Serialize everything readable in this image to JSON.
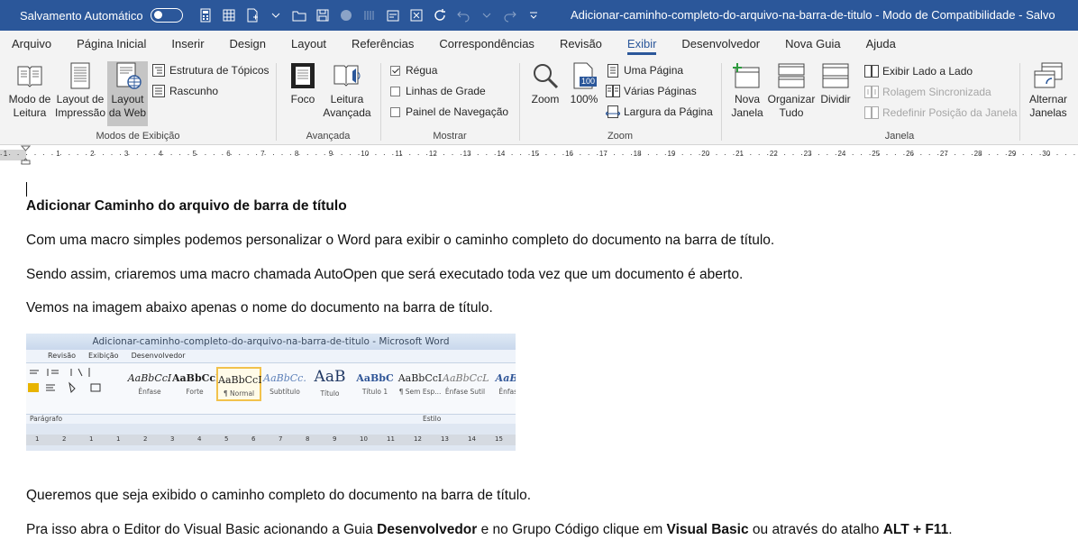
{
  "titlebar": {
    "autosave_label": "Salvamento Automático",
    "document_title": "Adicionar-caminho-completo-do-arquivo-na-barra-de-titulo  -  Modo de Compatibilidade  -  Salvo"
  },
  "tabs": [
    {
      "label": "Arquivo"
    },
    {
      "label": "Página Inicial"
    },
    {
      "label": "Inserir"
    },
    {
      "label": "Design"
    },
    {
      "label": "Layout"
    },
    {
      "label": "Referências"
    },
    {
      "label": "Correspondências"
    },
    {
      "label": "Revisão"
    },
    {
      "label": "Exibir",
      "active": true
    },
    {
      "label": "Desenvolvedor"
    },
    {
      "label": "Nova Guia"
    },
    {
      "label": "Ajuda"
    }
  ],
  "ribbon": {
    "views": {
      "label": "Modos de Exibição",
      "read_mode": "Modo de\nLeitura",
      "print_layout": "Layout de\nImpressão",
      "web_layout": "Layout\nda Web",
      "outline": "Estrutura de Tópicos",
      "draft": "Rascunho"
    },
    "immersive": {
      "label": "Avançada",
      "focus": "Foco",
      "immersive_reader": "Leitura\nAvançada"
    },
    "show": {
      "label": "Mostrar",
      "ruler": "Régua",
      "gridlines": "Linhas de Grade",
      "nav_pane": "Painel de Navegação"
    },
    "zoom": {
      "label": "Zoom",
      "zoom": "Zoom",
      "percent": "100%",
      "icon_badge": "100",
      "one_page": "Uma Página",
      "multiple_pages": "Várias Páginas",
      "page_width": "Largura da Página"
    },
    "window": {
      "label": "Janela",
      "new_window": "Nova\nJanela",
      "arrange_all": "Organizar\nTudo",
      "split": "Dividir",
      "side_by_side": "Exibir Lado a Lado",
      "sync_scroll": "Rolagem Sincronizada",
      "reset_position": "Redefinir Posição da Janela",
      "switch_windows": "Alternar\nJanelas"
    }
  },
  "ruler": {
    "numbers": [
      "1",
      "1",
      "2",
      "3",
      "4",
      "5",
      "6",
      "7",
      "8",
      "9",
      "10",
      "11",
      "12",
      "13",
      "14",
      "15",
      "16",
      "17",
      "18",
      "19",
      "20",
      "21",
      "22",
      "23",
      "24",
      "25",
      "26",
      "27",
      "28",
      "29",
      "30"
    ]
  },
  "document": {
    "heading": "Adicionar Caminho do arquivo de barra de título",
    "p1": "Com uma macro simples podemos personalizar o Word para exibir o caminho completo do documento na barra de título.",
    "p2": "Sendo assim, criaremos uma macro chamada AutoOpen que será executado toda vez que um documento é aberto.",
    "p3": "Vemos na imagem abaixo apenas o nome do documento na barra de título.",
    "p4": "Queremos que seja exibido o caminho completo do documento na barra de título.",
    "p5_a": "Pra isso abra o Editor do Visual Basic acionando a Guia ",
    "p5_b": "Desenvolvedor",
    "p5_c": " e no Grupo Código clique em ",
    "p5_d": "Visual Basic",
    "p5_e": " ou através do atalho ",
    "p5_f": "ALT + F11",
    "p5_g": "."
  },
  "embedded_image": {
    "title": "Adicionar-caminho-completo-do-arquivo-na-barra-de-titulo  -  Microsoft Word",
    "tabs": [
      "Revisão",
      "Exibição",
      "Desenvolvedor"
    ],
    "styles": [
      {
        "sample": "AaBbCcI",
        "name": "Ênfase"
      },
      {
        "sample": "AaBbCcI",
        "name": "Forte"
      },
      {
        "sample": "AaBbCcI",
        "name": "¶ Normal"
      },
      {
        "sample": "AaBbCc.",
        "name": "Subtítulo"
      },
      {
        "sample": "AaB",
        "name": "Título"
      },
      {
        "sample": "AaBbC",
        "name": "Título 1"
      },
      {
        "sample": "AaBbCcI",
        "name": "¶ Sem Esp..."
      },
      {
        "sample": "AaBbCcL",
        "name": "Ênfase Sutil"
      },
      {
        "sample": "AaBb",
        "name": "Ênfase"
      }
    ],
    "group_paragraph": "Parágrafo",
    "group_style": "Estilo",
    "ruler_numbers": [
      "1",
      "2",
      "1",
      "1",
      "2",
      "3",
      "4",
      "5",
      "6",
      "7",
      "8",
      "9",
      "10",
      "11",
      "12",
      "13",
      "14",
      "15"
    ]
  }
}
